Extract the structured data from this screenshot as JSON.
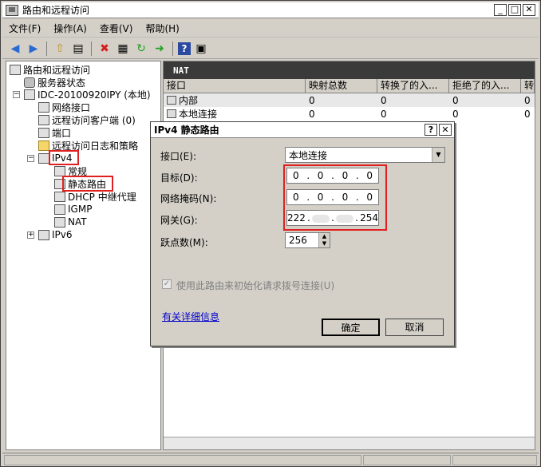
{
  "window": {
    "title": "路由和远程访问"
  },
  "menu": [
    "文件(F)",
    "操作(A)",
    "查看(V)",
    "帮助(H)"
  ],
  "tree": {
    "root": "路由和远程访问",
    "server_status": "服务器状态",
    "server": "IDC-20100920IPY (本地)",
    "net_if": "网络接口",
    "remote_clients": "远程访问客户端 (0)",
    "ports": "端口",
    "log_policy": "远程访问日志和策略",
    "ipv4": "IPv4",
    "general": "常规",
    "static_route": "静态路由",
    "dhcp": "DHCP 中继代理",
    "igmp": "IGMP",
    "nat": "NAT",
    "ipv6": "IPv6"
  },
  "right": {
    "header": "NAT",
    "columns": [
      "接口",
      "映射总数",
      "转换了的入...",
      "拒绝了的入...",
      "转"
    ],
    "rows": [
      {
        "name": "内部",
        "c1": "0",
        "c2": "0",
        "c3": "0",
        "c4": "0"
      },
      {
        "name": "本地连接",
        "c1": "0",
        "c2": "0",
        "c3": "0",
        "c4": "0"
      }
    ]
  },
  "dialog": {
    "title": "IPv4 静态路由",
    "interface_label": "接口(E):",
    "interface_value": "本地连接",
    "target_label": "目标(D):",
    "target": [
      "0",
      "0",
      "0",
      "0"
    ],
    "mask_label": "网络掩码(N):",
    "mask": [
      "0",
      "0",
      "0",
      "0"
    ],
    "gateway_label": "网关(G):",
    "gateway": [
      "222",
      "",
      "",
      "254"
    ],
    "hops_label": "跃点数(M):",
    "hops_value": "256",
    "checkbox_label": "使用此路由来初始化请求拨号连接(U)",
    "link": "有关详细信息",
    "ok": "确定",
    "cancel": "取消"
  },
  "colors": {
    "highlight": "#e02020",
    "link": "#0000cc",
    "header": "#3a3a3a"
  }
}
